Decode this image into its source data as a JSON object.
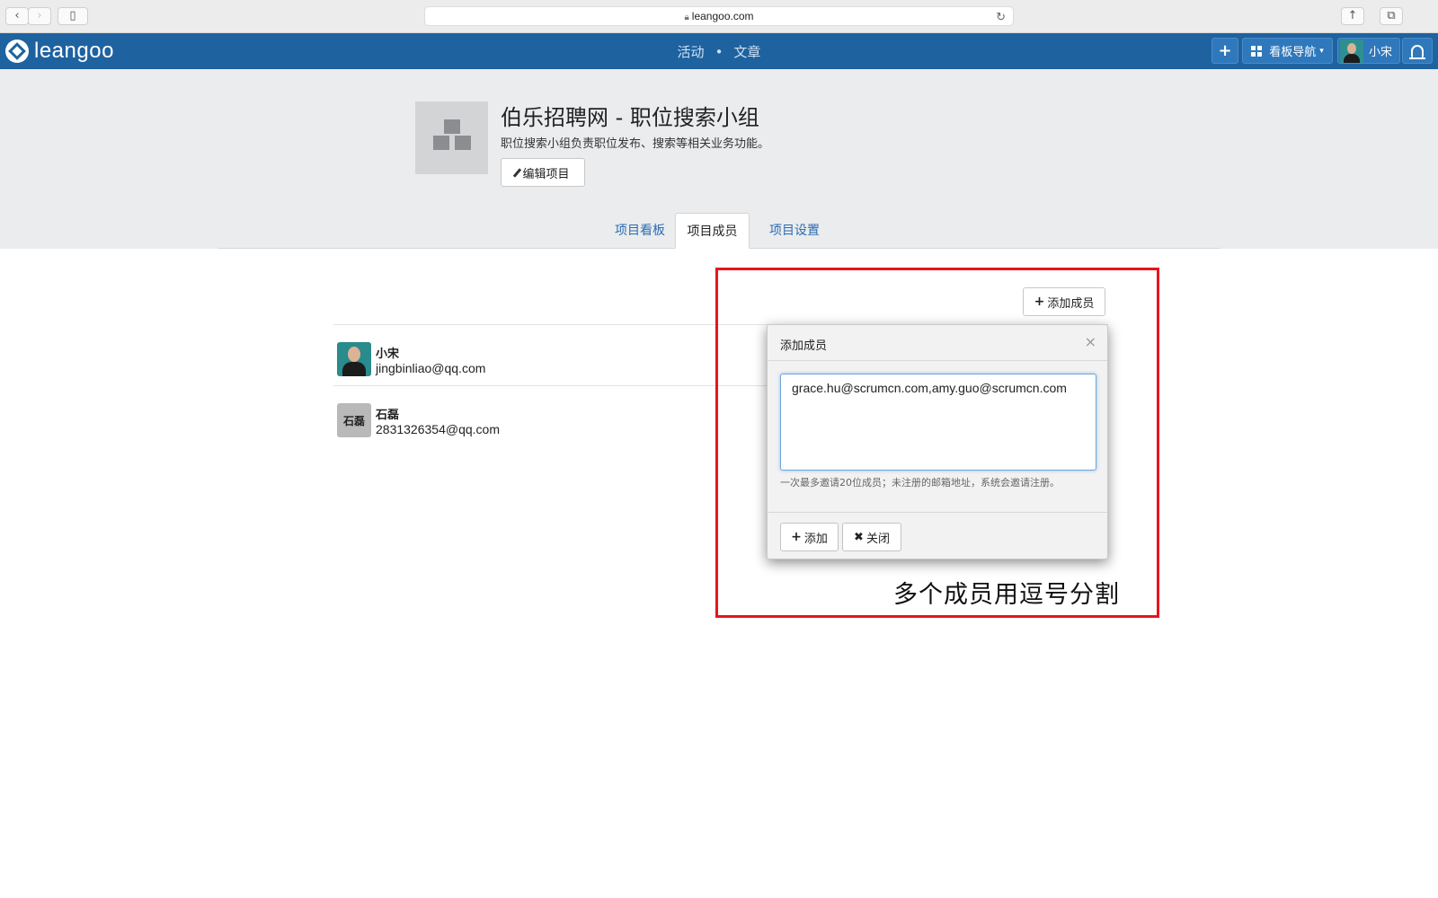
{
  "browser": {
    "url": "leangoo.com"
  },
  "header": {
    "logo_text": "leangoo",
    "links": [
      "活动",
      "文章"
    ],
    "separator": "•",
    "plus_label": "+",
    "board_nav_label": "看板导航",
    "user_name": "小宋"
  },
  "project": {
    "title": "伯乐招聘网 - 职位搜索小组",
    "description": "职位搜索小组负责职位发布、搜索等相关业务功能。",
    "edit_label": "编辑项目"
  },
  "tabs": [
    {
      "label": "项目看板",
      "active": false
    },
    {
      "label": "项目成员",
      "active": true
    },
    {
      "label": "项目设置",
      "active": false
    }
  ],
  "members": {
    "add_label": "添加成员",
    "list": [
      {
        "name": "小宋",
        "email": "jingbinliao@qq.com",
        "avatar": "photo"
      },
      {
        "name": "石磊",
        "email": "2831326354@qq.com",
        "avatar": "石磊"
      }
    ]
  },
  "modal": {
    "title": "添加成员",
    "close_glyph": "×",
    "textarea_value": "grace.hu@scrumcn.com,amy.guo@scrumcn.com",
    "hint": "一次最多邀请20位成员；未注册的邮箱地址，系统会邀请注册。",
    "add_label": "添加",
    "close_label": "关闭"
  },
  "annotation": "多个成员用逗号分割",
  "colors": {
    "header_bg": "#1e62a0",
    "link_blue": "#2a6cb4",
    "highlight_red": "#e8141c"
  }
}
